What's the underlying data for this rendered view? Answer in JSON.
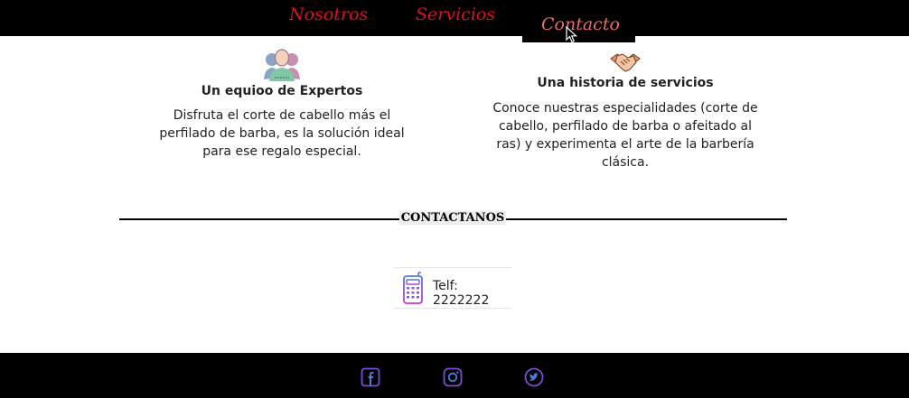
{
  "nav": {
    "items": [
      {
        "label": "Nosotros"
      },
      {
        "label": "Servicios"
      },
      {
        "label": "Contacto"
      }
    ],
    "active": "Contacto",
    "colors": {
      "link": "#e0101a",
      "active": "#e86a6a",
      "background": "#000000"
    }
  },
  "features": [
    {
      "icon": "team-icon",
      "title": "Un equioo de Expertos",
      "text": "Disfruta el corte de cabello más el perfilado de barba, es la solución ideal para ese regalo especial."
    },
    {
      "icon": "handshake-icon",
      "title": "Una historia de servicios",
      "text": "Conoce nuestras especialidades (corte de cabello, perfilado de barba o afeitado al ras) y experimenta el arte de la barbería clásica."
    }
  ],
  "section": {
    "heading": "CONTACTANOS"
  },
  "contact": {
    "icon": "phone-icon",
    "phone": "Telf: 2222222"
  },
  "footer": {
    "social": [
      "facebook-icon",
      "instagram-icon",
      "twitter-icon"
    ],
    "icon_color": "#7b4dd6"
  }
}
